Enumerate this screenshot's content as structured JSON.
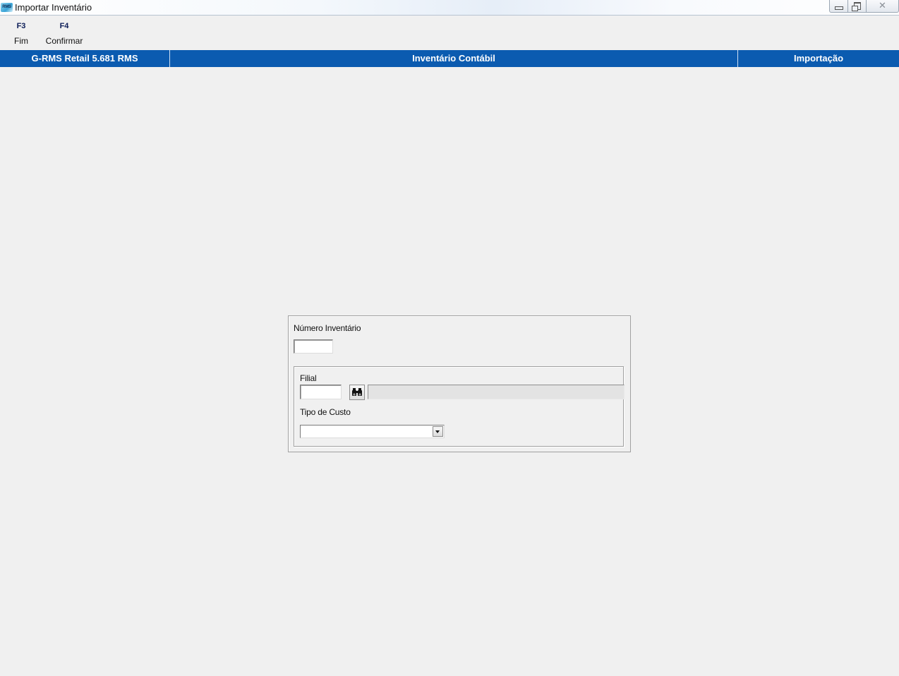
{
  "window": {
    "title": "Importar Inventário",
    "icon_text": "RMS",
    "controls": [
      "minimize-icon",
      "restore-icon",
      "close-icon"
    ],
    "close_glyph": "✕"
  },
  "toolbar": {
    "items": [
      {
        "key": "F3",
        "label": "Fim"
      },
      {
        "key": "F4",
        "label": "Confirmar"
      }
    ]
  },
  "header": {
    "left": "G-RMS Retail 5.681 RMS",
    "center": "Inventário Contábil",
    "right": "Importação",
    "bg_color": "#0b5bb0"
  },
  "form": {
    "numero_inventario": {
      "label": "Número Inventário",
      "value": ""
    },
    "filial": {
      "label": "Filial",
      "value": "",
      "description": "",
      "search_icon": "binoculars-icon"
    },
    "tipo_custo": {
      "label": "Tipo de Custo",
      "selected": ""
    }
  }
}
